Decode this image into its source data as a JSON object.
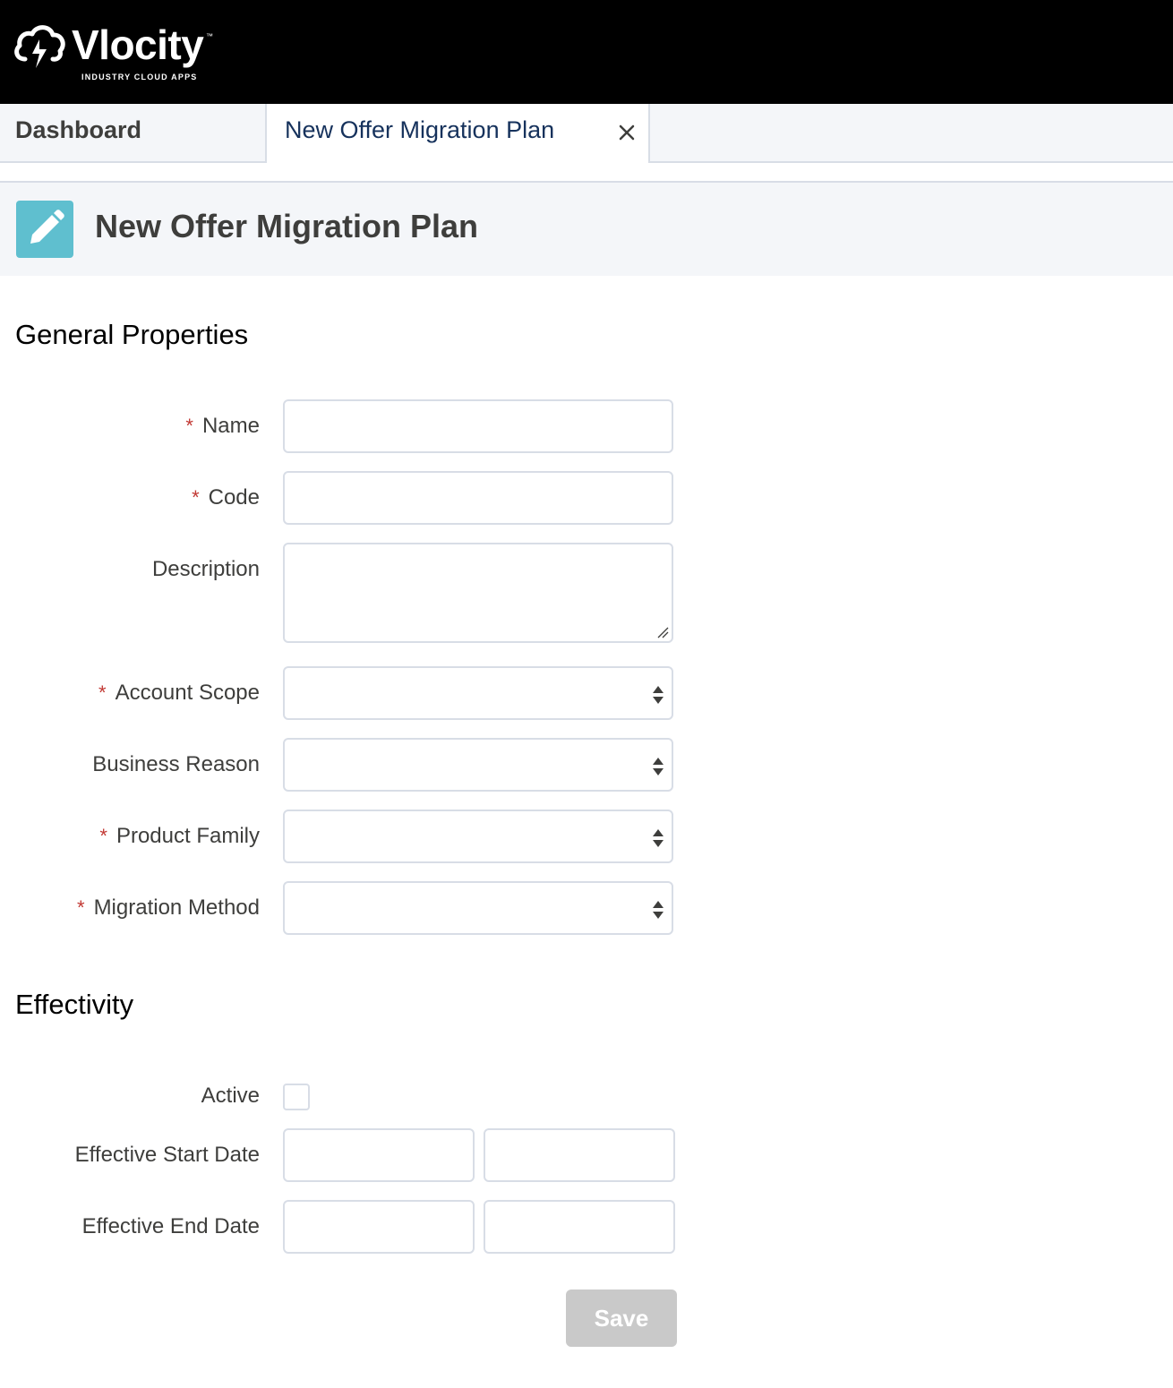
{
  "brand": {
    "name": "Vlocity",
    "trademark": "™",
    "tagline": "INDUSTRY CLOUD APPS"
  },
  "tabs": [
    {
      "label": "Dashboard",
      "active": false
    },
    {
      "label": "New Offer Migration Plan",
      "active": true,
      "closable": true
    }
  ],
  "header": {
    "title": "New Offer Migration Plan",
    "icon": "pencil-icon"
  },
  "sections": {
    "general": {
      "title": "General Properties"
    },
    "effectivity": {
      "title": "Effectivity"
    }
  },
  "fields": {
    "name": {
      "label": "Name",
      "required": true,
      "value": ""
    },
    "code": {
      "label": "Code",
      "required": true,
      "value": ""
    },
    "description": {
      "label": "Description",
      "required": false,
      "value": ""
    },
    "account_scope": {
      "label": "Account Scope",
      "required": true,
      "value": ""
    },
    "business_reason": {
      "label": "Business Reason",
      "required": false,
      "value": ""
    },
    "product_family": {
      "label": "Product Family",
      "required": true,
      "value": ""
    },
    "migration_method": {
      "label": "Migration Method",
      "required": true,
      "value": ""
    },
    "active": {
      "label": "Active",
      "checked": false
    },
    "effective_start_date": {
      "label": "Effective Start Date",
      "date": "",
      "time": ""
    },
    "effective_end_date": {
      "label": "Effective End Date",
      "date": "",
      "time": ""
    }
  },
  "required_marker": "*",
  "save_label": "Save",
  "colors": {
    "topbar": "#000000",
    "header_icon_bg": "#5fbfcf",
    "required": "#c23934",
    "save_disabled": "#c9c9c9"
  }
}
